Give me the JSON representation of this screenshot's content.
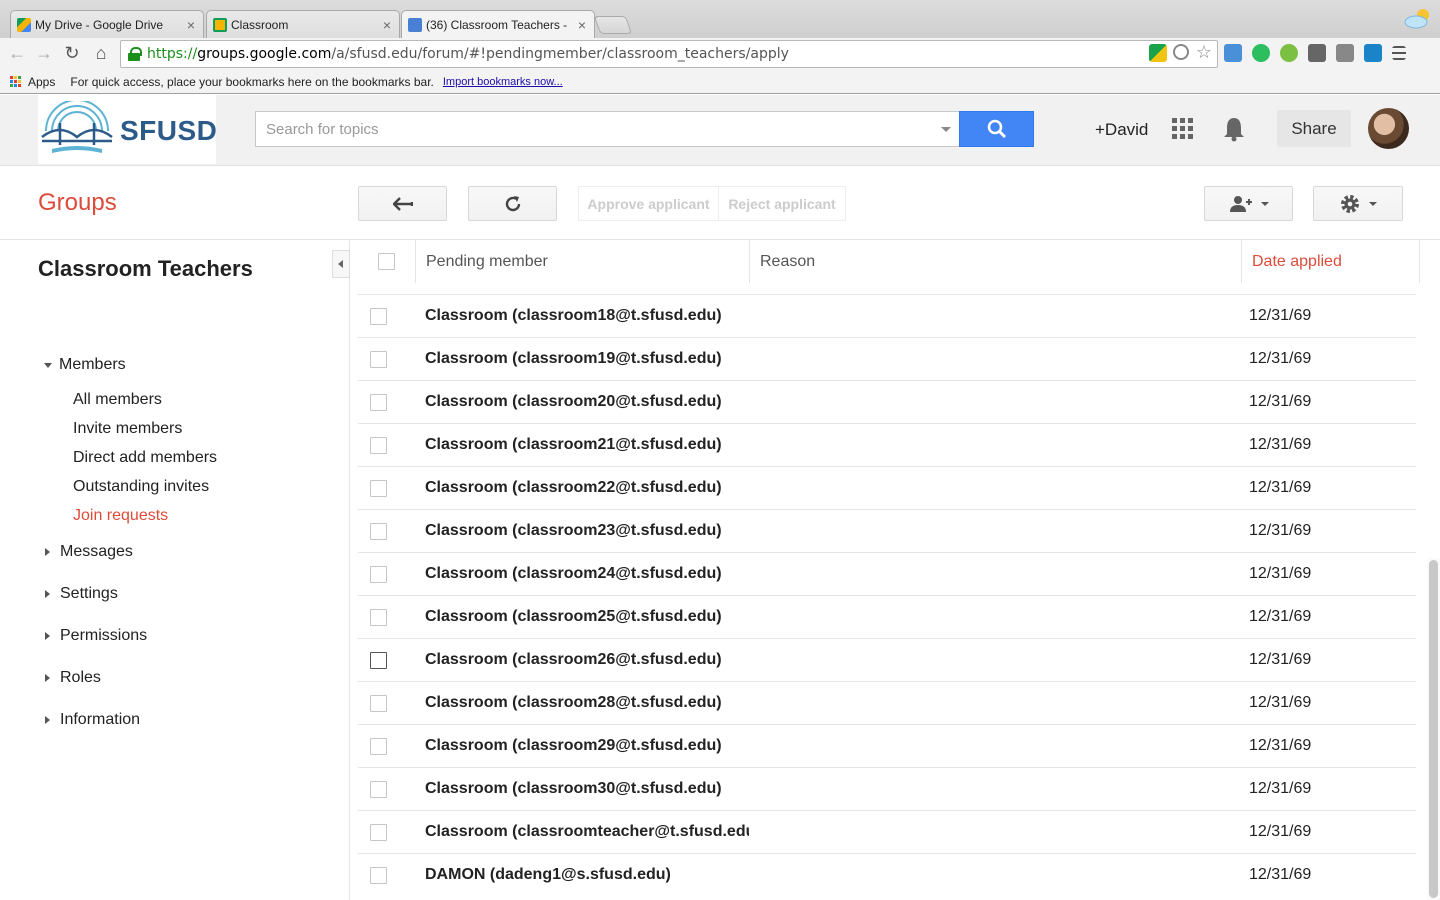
{
  "browser": {
    "tabs": [
      {
        "label": "My Drive - Google Drive"
      },
      {
        "label": "Classroom"
      },
      {
        "label": "(36) Classroom Teachers -"
      }
    ],
    "url": {
      "scheme": "https://",
      "host": "groups.google.com",
      "path": "/a/sfusd.edu/forum/#!pendingmember/classroom_teachers/apply"
    },
    "bookmarks": {
      "apps_label": "Apps",
      "hint": "For quick access, place your bookmarks here on the bookmarks bar.",
      "import_link": "Import bookmarks now..."
    }
  },
  "header": {
    "logo_text": "SFUSD",
    "search_placeholder": "Search for topics",
    "user_label": "+David",
    "share_label": "Share"
  },
  "groups": {
    "title": "Groups",
    "actions": {
      "approve": "Approve applicant",
      "reject": "Reject applicant"
    }
  },
  "sidebar": {
    "group_name": "Classroom Teachers",
    "members_label": "Members",
    "member_items": [
      {
        "label": "All members"
      },
      {
        "label": "Invite members"
      },
      {
        "label": "Direct add members"
      },
      {
        "label": "Outstanding invites"
      },
      {
        "label": "Join requests"
      }
    ],
    "sections": [
      {
        "label": "Messages"
      },
      {
        "label": "Settings"
      },
      {
        "label": "Permissions"
      },
      {
        "label": "Roles"
      },
      {
        "label": "Information"
      }
    ]
  },
  "table": {
    "columns": {
      "member": "Pending member",
      "reason": "Reason",
      "date": "Date applied"
    },
    "rows": [
      {
        "member": "Classroom (classroom18@t.sfusd.edu)",
        "date": "12/31/69"
      },
      {
        "member": "Classroom (classroom19@t.sfusd.edu)",
        "date": "12/31/69"
      },
      {
        "member": "Classroom (classroom20@t.sfusd.edu)",
        "date": "12/31/69"
      },
      {
        "member": "Classroom (classroom21@t.sfusd.edu)",
        "date": "12/31/69"
      },
      {
        "member": "Classroom (classroom22@t.sfusd.edu)",
        "date": "12/31/69"
      },
      {
        "member": "Classroom (classroom23@t.sfusd.edu)",
        "date": "12/31/69"
      },
      {
        "member": "Classroom (classroom24@t.sfusd.edu)",
        "date": "12/31/69"
      },
      {
        "member": "Classroom (classroom25@t.sfusd.edu)",
        "date": "12/31/69"
      },
      {
        "member": "Classroom (classroom26@t.sfusd.edu)",
        "date": "12/31/69"
      },
      {
        "member": "Classroom (classroom28@t.sfusd.edu)",
        "date": "12/31/69"
      },
      {
        "member": "Classroom (classroom29@t.sfusd.edu)",
        "date": "12/31/69"
      },
      {
        "member": "Classroom (classroom30@t.sfusd.edu)",
        "date": "12/31/69"
      },
      {
        "member": "Classroom (classroomteacher@t.sfusd.edu)",
        "date": "12/31/69"
      },
      {
        "member": "DAMON (dadeng1@s.sfusd.edu)",
        "date": "12/31/69"
      }
    ]
  },
  "colors": {
    "accent_red": "#dd4b39",
    "search_blue": "#4285f4"
  }
}
